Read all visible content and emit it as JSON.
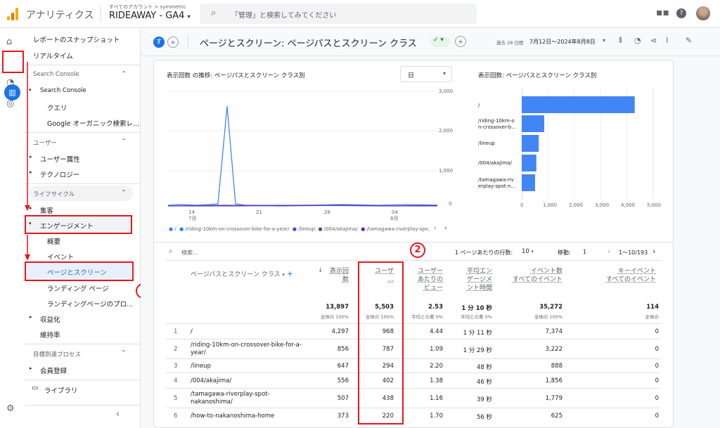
{
  "app": {
    "title": "アナリティクス",
    "account_crumb": "すべてのアカウント > symmetric",
    "property": "RIDEAWAY - GA4",
    "search_placeholder": "「管理」と検索してみてください"
  },
  "nav": {
    "snapshot": "レポートのスナップショット",
    "realtime": "リアルタイム",
    "sc_section": "Search Console",
    "sc_item": "Search Console",
    "query": "クエリ",
    "organic": "Google オーガニック検索レ...",
    "user_section": "ユーザー",
    "user_attr": "ユーザー属性",
    "tech": "テクノロジー",
    "lifecycle": "ライフサイクル",
    "acq": "集客",
    "engagement": "エンゲージメント",
    "overview": "概要",
    "events": "イベント",
    "pages": "ページとスクリーン",
    "landing": "ランディング ページ",
    "landing_pro": "ランディングページのプロ...",
    "monet": "収益化",
    "retention": "維持率",
    "goal_section": "目標到達プロセス",
    "membership": "会員登録",
    "library": "ライブラリ"
  },
  "header": {
    "badge": "す",
    "title": "ページとスクリーン: ページパスとスクリーン クラス",
    "date_label": "過去 28 日間",
    "date_range": "7月12日～2024年8月8日"
  },
  "line_chart": {
    "title": "表示回数 の推移: ページパスとスクリーン クラス別",
    "granularity": "日",
    "yticks": [
      "3,000",
      "2,000",
      "1,000",
      "0"
    ],
    "xticks": [
      "14",
      "21",
      "28",
      "04"
    ],
    "xsub": [
      "7月",
      "",
      "",
      "8月"
    ],
    "legend": [
      "/",
      "/riding-10km-on-crossover-bike-for-a-year/",
      "/lineup",
      "/004/akajima/",
      "/tamagawa-riverplay-spo"
    ],
    "colors": [
      "#4285f4",
      "#1e88e5",
      "#3f51b5",
      "#673ab7",
      "#7b1fa2"
    ]
  },
  "bar_chart": {
    "title": "表示回数: ページパスとスクリーン クラス別",
    "labels": [
      "/",
      "/riding-10km-o\nn-crossover-b...",
      "/lineup",
      "/004/akajima/",
      "/tamagawa-riv\nerplay-spot-n..."
    ],
    "xticks": [
      "0",
      "1,000",
      "2,000",
      "3,000",
      "4,000",
      "5,000"
    ]
  },
  "chart_data": {
    "type": "bar",
    "categories": [
      "/",
      "/riding-10km-on-crossover-bike-for-a-year/",
      "/lineup",
      "/004/akajima/",
      "/tamagawa-riverplay-spot-nakanoshima/"
    ],
    "values": [
      4297,
      856,
      647,
      556,
      507
    ],
    "title": "表示回数: ページパスとスクリーン クラス別",
    "xlim": [
      0,
      5000
    ]
  },
  "table": {
    "search": "検索...",
    "rows_per_page_label": "1 ページあたりの行数:",
    "rows_per_page": "10",
    "goto_label": "移動:",
    "goto": "1",
    "pagination": "1～10/193",
    "col_dim": "ページパスとスクリーン クラス",
    "col_views": "表示回\n数",
    "col_users": "ユーザ\n...",
    "col_vpu": "ユーザー\nあたりの\nビュー",
    "col_eng": "平均エン\nゲージメ\nント時間",
    "col_events": "イベント数\nすべてのイベント",
    "col_key": "キーイベント\nすべてのイベント",
    "totals": {
      "views": "13,897",
      "views_sub": "全体の 100%",
      "users": "5,503",
      "users_sub": "全体の 100%",
      "vpu": "2.53",
      "vpu_sub": "平均との差 0%",
      "eng": "1 分 10 秒",
      "eng_sub": "平均との差 0%",
      "events": "35,272",
      "events_sub": "全体の 100%",
      "key": "114",
      "key_sub": "全体の"
    },
    "rows": [
      {
        "n": "1",
        "path": "/",
        "views": "4,297",
        "users": "968",
        "vpu": "4.44",
        "eng": "1 分 11 秒",
        "events": "7,374",
        "key": "0"
      },
      {
        "n": "2",
        "path": "/riding-10km-on-crossover-bike-for-a-\nyear/",
        "views": "856",
        "users": "787",
        "vpu": "1.09",
        "eng": "1 分 29 秒",
        "events": "3,222",
        "key": "0"
      },
      {
        "n": "3",
        "path": "/lineup",
        "views": "647",
        "users": "294",
        "vpu": "2.20",
        "eng": "48 秒",
        "events": "888",
        "key": "0"
      },
      {
        "n": "4",
        "path": "/004/akajima/",
        "views": "556",
        "users": "402",
        "vpu": "1.38",
        "eng": "46 秒",
        "events": "1,856",
        "key": "0"
      },
      {
        "n": "5",
        "path": "/tamagawa-riverplay-spot-\nnakanoshima/",
        "views": "507",
        "users": "438",
        "vpu": "1.16",
        "eng": "39 秒",
        "events": "1,779",
        "key": "0"
      },
      {
        "n": "6",
        "path": "/how-to-nakanoshima-home",
        "views": "373",
        "users": "220",
        "vpu": "1.70",
        "eng": "56 秒",
        "events": "625",
        "key": "0"
      }
    ]
  },
  "annotations": {
    "one": "1",
    "two": "2"
  }
}
